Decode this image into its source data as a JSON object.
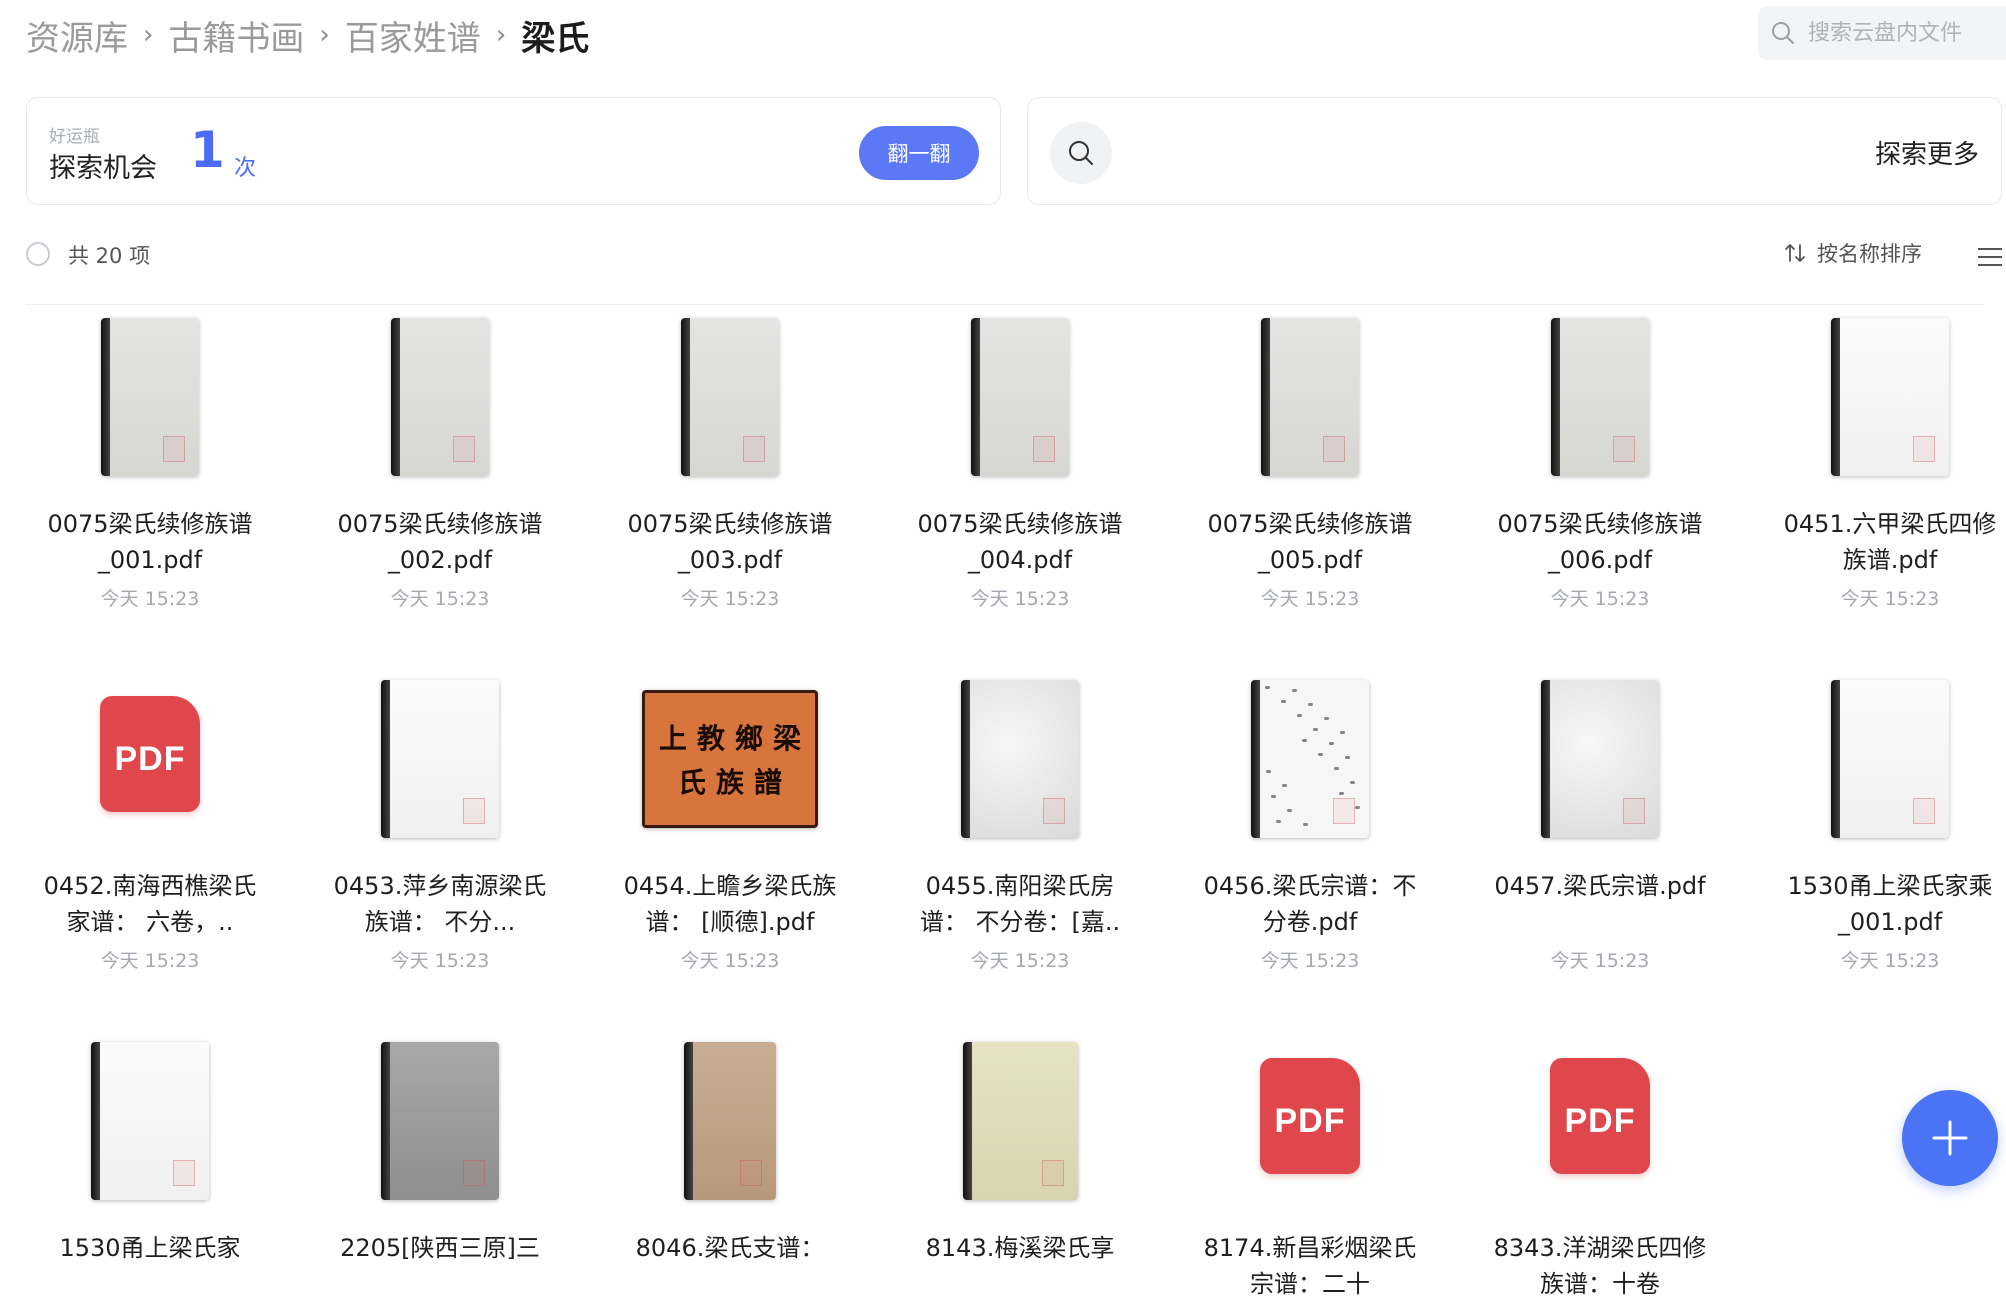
{
  "breadcrumb": {
    "items": [
      "资源库",
      "古籍书画",
      "百家姓谱"
    ],
    "separator": "›",
    "current": "梁氏"
  },
  "search": {
    "placeholder": "搜索云盘内文件"
  },
  "lucky": {
    "small_label": "好运瓶",
    "title": "探索机会",
    "count": "1",
    "unit": "次",
    "button_label": "翻一翻"
  },
  "explore": {
    "label": "探索更多"
  },
  "toolbar": {
    "total_label": "共 20 项",
    "sort_label": "按名称排序"
  },
  "colors": {
    "accent": "#4d6cf5",
    "pdf_red": "#e0474c",
    "fab_blue": "#4a73f5"
  },
  "files": [
    {
      "name": "0075梁氏续修族谱_001.pdf",
      "time": "今天 15:23",
      "thumb": "book-gray"
    },
    {
      "name": "0075梁氏续修族谱_002.pdf",
      "time": "今天 15:23",
      "thumb": "book-gray"
    },
    {
      "name": "0075梁氏续修族谱_003.pdf",
      "time": "今天 15:23",
      "thumb": "book-gray"
    },
    {
      "name": "0075梁氏续修族谱_004.pdf",
      "time": "今天 15:23",
      "thumb": "book-gray"
    },
    {
      "name": "0075梁氏续修族谱_005.pdf",
      "time": "今天 15:23",
      "thumb": "book-gray"
    },
    {
      "name": "0075梁氏续修族谱_006.pdf",
      "time": "今天 15:23",
      "thumb": "book-gray"
    },
    {
      "name": "0451.六甲梁氏四修族谱.pdf",
      "time": "今天 15:23",
      "thumb": "book-white"
    },
    {
      "name": "0452.南海西樵梁氏家谱： 六卷，..",
      "time": "今天 15:23",
      "thumb": "pdf-icon"
    },
    {
      "name": "0453.萍乡南源梁氏族谱： 不分...",
      "time": "今天 15:23",
      "thumb": "book-white"
    },
    {
      "name": "0454.上瞻乡梁氏族谱： [顺德].pdf",
      "time": "今天 15:23",
      "thumb": "cover-orange"
    },
    {
      "name": "0455.南阳梁氏房谱： 不分卷：[嘉..",
      "time": "今天 15:23",
      "thumb": "book-cloud"
    },
    {
      "name": "0456.梁氏宗谱：不分卷.pdf",
      "time": "今天 15:23",
      "thumb": "book-speckled"
    },
    {
      "name": "0457.梁氏宗谱.pdf",
      "time": "今天 15:23",
      "thumb": "book-cloud"
    },
    {
      "name": "1530甬上梁氏家乘_001.pdf",
      "time": "今天 15:23",
      "thumb": "book-white"
    },
    {
      "name": "1530甬上梁氏家",
      "time": "",
      "thumb": "book-white"
    },
    {
      "name": "2205[陕西三原]三",
      "time": "",
      "thumb": "book-darkgray"
    },
    {
      "name": "8046.梁氏支谱：",
      "time": "",
      "thumb": "book-tan"
    },
    {
      "name": "8143.梅溪梁氏享",
      "time": "",
      "thumb": "book-cream"
    },
    {
      "name": "8174.新昌彩烟梁氏宗谱：二十",
      "time": "",
      "thumb": "pdf-icon"
    },
    {
      "name": "8343.洋湖梁氏四修族谱：十卷",
      "time": "",
      "thumb": "pdf-icon"
    }
  ],
  "pdf_label": "PDF",
  "orange_cover_text": [
    "上",
    "教",
    "鄉",
    "梁",
    "氏",
    "族",
    "譜"
  ]
}
